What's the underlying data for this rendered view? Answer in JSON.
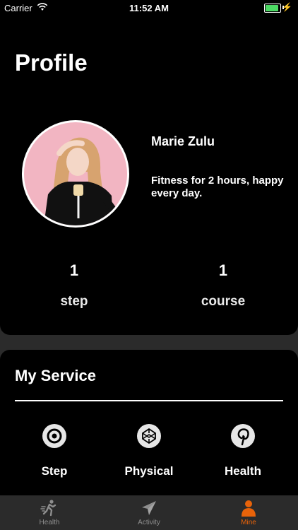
{
  "status_bar": {
    "carrier": "Carrier",
    "time": "11:52 AM",
    "battery_level": 0.9,
    "battery_color": "#4cd964"
  },
  "profile": {
    "title": "Profile",
    "name": "Marie Zulu",
    "bio": "Fitness for 2 hours, happy every day.",
    "stats": [
      {
        "value": "1",
        "label": "step"
      },
      {
        "value": "1",
        "label": "course"
      }
    ]
  },
  "service": {
    "title": "My Service",
    "items": [
      {
        "label": "Step",
        "icon": "target-icon"
      },
      {
        "label": "Physical",
        "icon": "codepen-icon"
      },
      {
        "label": "Health",
        "icon": "pinterest-icon"
      }
    ]
  },
  "tabs": [
    {
      "label": "Health",
      "icon": "running-icon",
      "active": false
    },
    {
      "label": "Activity",
      "icon": "paper-plane-icon",
      "active": false
    },
    {
      "label": "Mine",
      "icon": "person-icon",
      "active": true
    }
  ],
  "colors": {
    "active_tab": "#e8630a",
    "inactive_tab": "#8e8e8e",
    "card_bg": "#000000",
    "page_bg": "#2b2b2b"
  }
}
